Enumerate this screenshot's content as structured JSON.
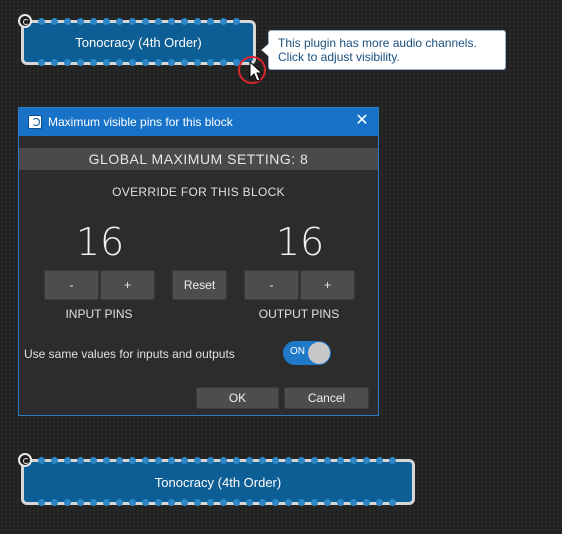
{
  "block_top": {
    "title": "Tonocracy (4th Order)"
  },
  "tooltip": {
    "line1": "This plugin has more audio channels.",
    "line2": "Click to adjust visibility."
  },
  "dialog": {
    "title": "Maximum visible pins for this block",
    "close_glyph": "✕",
    "global_setting": "GLOBAL MAXIMUM SETTING: 8",
    "override_label": "OVERRIDE FOR THIS BLOCK",
    "input_pins": {
      "value": "16",
      "minus": "-",
      "plus": "+",
      "label": "INPUT PINS"
    },
    "output_pins": {
      "value": "16",
      "minus": "-",
      "plus": "+",
      "label": "OUTPUT PINS"
    },
    "reset_label": "Reset",
    "same_values_label": "Use same values for inputs and outputs",
    "toggle": {
      "label": "ON",
      "state": true
    },
    "ok_label": "OK",
    "cancel_label": "Cancel"
  },
  "block_bottom": {
    "title": "Tonocracy (4th Order)"
  },
  "colors": {
    "block": "#0d5e95",
    "pin": "#2e88c6",
    "accent": "#1772c8",
    "highlight_ring": "#d8262e"
  },
  "icons": [
    "expand-pins-icon",
    "settings-icon",
    "app-icon",
    "close-icon",
    "mouse-cursor-icon"
  ]
}
